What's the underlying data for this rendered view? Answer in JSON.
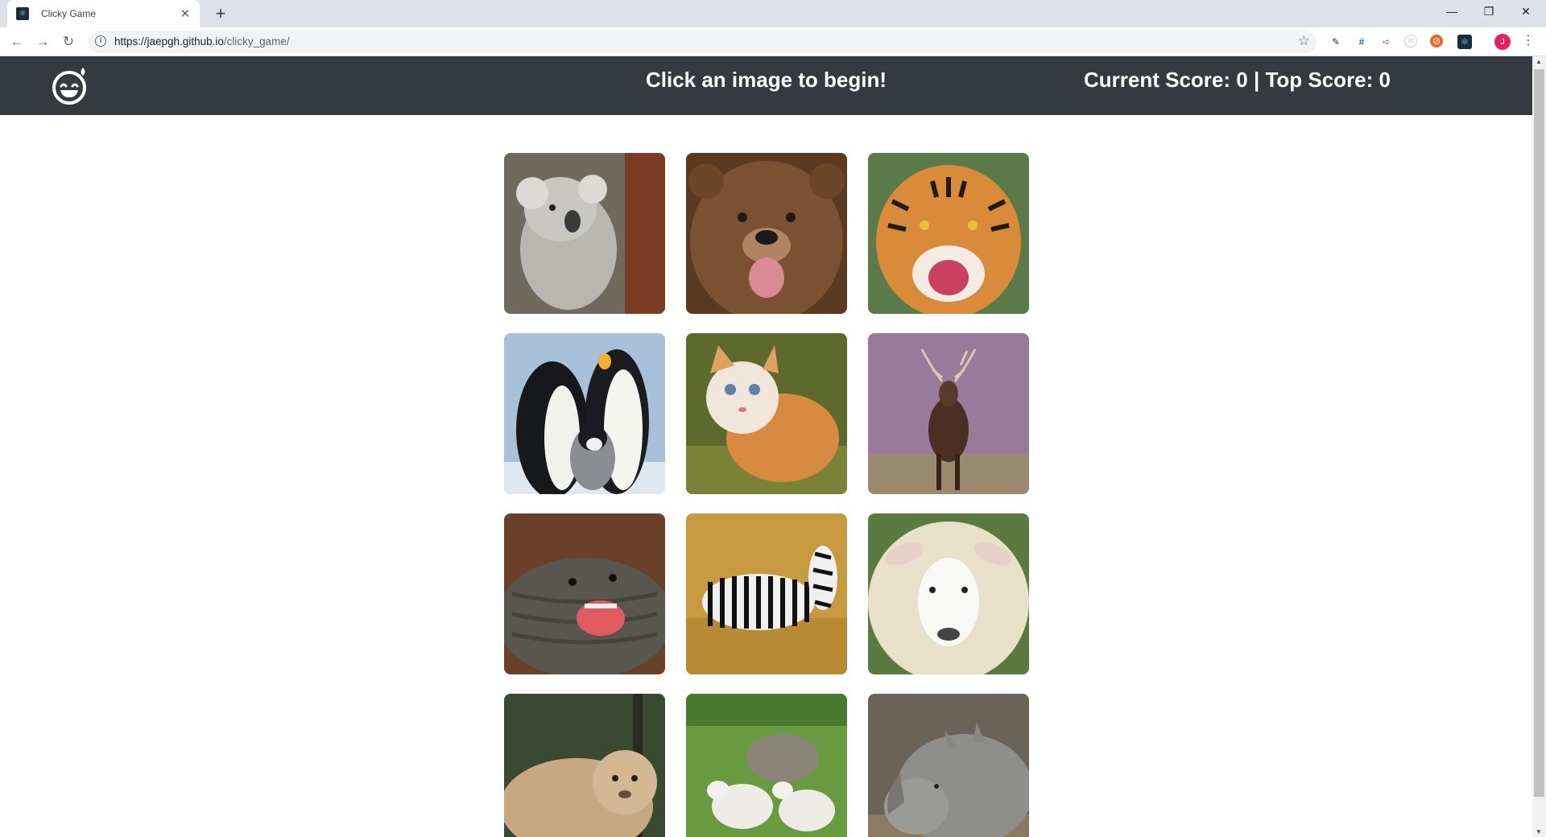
{
  "browser": {
    "tab_title": "Clicky Game",
    "url_host": "https://jaepgh.github.io",
    "url_path": "/clicky_game/",
    "profile_initial": "J"
  },
  "page": {
    "status_message": "Click an image to begin!",
    "score_text": "Current Score: 0 | Top Score: 0"
  },
  "cards": [
    {
      "animal": "koala"
    },
    {
      "animal": "bear"
    },
    {
      "animal": "tiger"
    },
    {
      "animal": "penguins"
    },
    {
      "animal": "kitten"
    },
    {
      "animal": "deer"
    },
    {
      "animal": "elephant-seal"
    },
    {
      "animal": "zebras"
    },
    {
      "animal": "sheep"
    },
    {
      "animal": "liger"
    },
    {
      "animal": "lambs"
    },
    {
      "animal": "rhino"
    }
  ],
  "colors": {
    "navbar": "#343a40",
    "navbar_text": "#ffffff"
  }
}
